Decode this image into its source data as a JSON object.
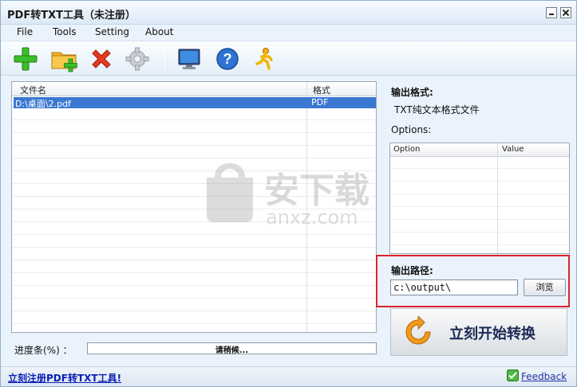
{
  "window": {
    "title": "PDF转TXT工具（未注册）"
  },
  "menu": {
    "file": "File",
    "tools": "Tools",
    "setting": "Setting",
    "about": "About"
  },
  "toolbar": {
    "icons": [
      "plus-icon",
      "add-folder-icon",
      "delete-icon",
      "gear-icon",
      "monitor-icon",
      "help-icon",
      "runner-icon"
    ]
  },
  "filelist": {
    "headers": {
      "name": "文件名",
      "format": "格式"
    },
    "rows": [
      {
        "name": "D:\\桌面\\2.pdf",
        "format": "PDF"
      }
    ]
  },
  "watermark": {
    "text": "安下载",
    "subtext": "anxz.com"
  },
  "progress": {
    "label": "进度条(%) ：",
    "status": "请稍候..."
  },
  "panel": {
    "output_format_label": "输出格式:",
    "output_format_value": "TXT纯文本格式文件",
    "options_label": "Options:",
    "options_headers": {
      "option": "Option",
      "value": "Value"
    },
    "output_path_label": "输出路径:",
    "output_path_value": "c:\\output\\",
    "browse_label": "浏览",
    "start_label": "立刻开始转换"
  },
  "statusbar": {
    "register_link": "立刻注册PDF转TXT工具!",
    "feedback": "Feedback"
  },
  "colors": {
    "selection": "#3a78d2",
    "highlight_border": "#e0222a",
    "link": "#0b1fb3"
  }
}
